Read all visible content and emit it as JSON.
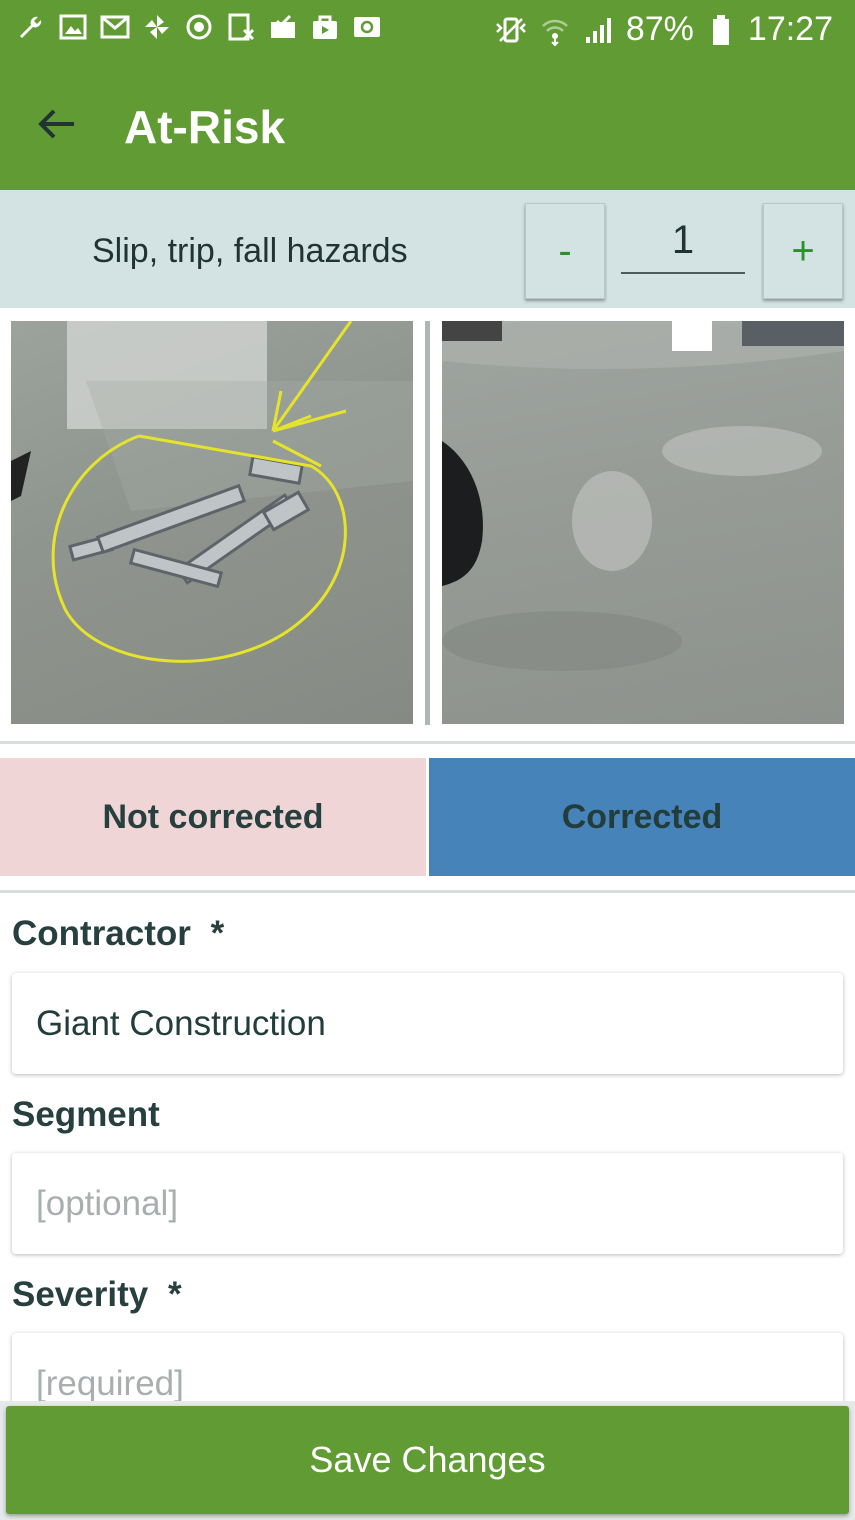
{
  "status_bar": {
    "battery": "87%",
    "time": "17:27",
    "left_icons": [
      "wrench-icon",
      "image-icon",
      "gmail-icon",
      "pinwheel-icon",
      "sync-icon",
      "receipt-icon",
      "mail-check-icon",
      "shopping-bag-icon",
      "at-mail-icon"
    ],
    "right_icons": [
      "vibrate-icon",
      "wifi-icon",
      "signal-icon",
      "battery-icon"
    ]
  },
  "app_bar": {
    "title": "At-Risk",
    "color": "#619b33"
  },
  "hazard": {
    "label": "Slip, trip, fall hazards",
    "minus_label": "-",
    "plus_label": "+",
    "count": "1"
  },
  "photos": [
    {
      "name": "before-photo",
      "description_icon": "photo-icon"
    },
    {
      "name": "after-photo",
      "description_icon": "photo-icon"
    }
  ],
  "correction": {
    "not_corrected_label": "Not corrected",
    "corrected_label": "Corrected",
    "not_corrected_color": "#efd5d5",
    "corrected_color": "#4683b8"
  },
  "form": {
    "contractor": {
      "label": "Contractor",
      "required_mark": "*",
      "value": "Giant Construction"
    },
    "segment": {
      "label": "Segment",
      "placeholder": "[optional]"
    },
    "severity": {
      "label": "Severity",
      "required_mark": "*",
      "placeholder": "[required]"
    }
  },
  "save": {
    "label": "Save Changes"
  }
}
